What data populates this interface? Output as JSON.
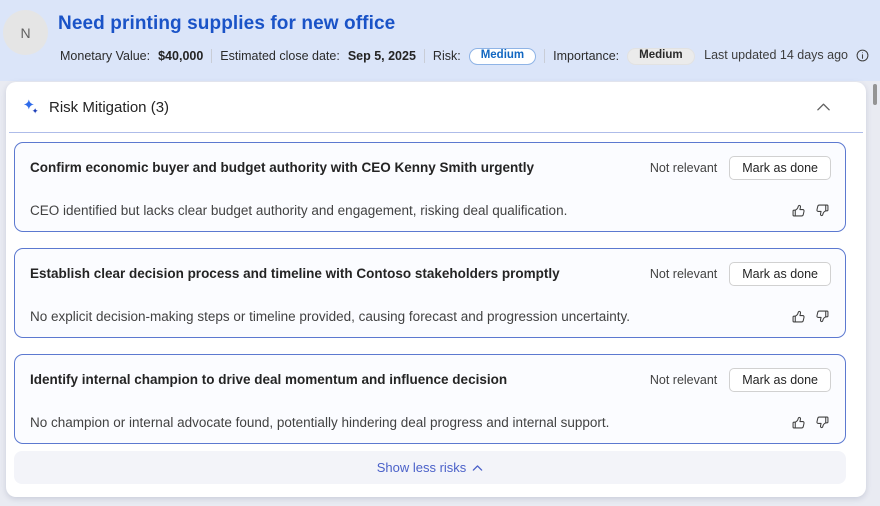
{
  "header": {
    "avatar_initial": "N",
    "title": "Need printing supplies for new office",
    "fields": [
      {
        "label": "Monetary Value:",
        "value": "$40,000"
      },
      {
        "label": "Estimated close date:",
        "value": "Sep 5, 2025"
      }
    ],
    "risk": {
      "label": "Risk:",
      "value": "Medium"
    },
    "importance": {
      "label": "Importance:",
      "value": "Medium"
    },
    "last_updated": "Last updated 14 days ago"
  },
  "section": {
    "title": "Risk Mitigation (3)"
  },
  "card_actions": {
    "not_relevant": "Not relevant",
    "mark_as_done": "Mark as done"
  },
  "risks": [
    {
      "title": "Confirm economic buyer and budget authority with CEO Kenny Smith urgently",
      "description": "CEO identified but lacks clear budget authority and engagement, risking deal qualification."
    },
    {
      "title": "Establish clear decision process and timeline with Contoso stakeholders promptly",
      "description": "No explicit decision-making steps or timeline provided, causing forecast and progression uncertainty."
    },
    {
      "title": "Identify internal champion to drive deal momentum and influence decision",
      "description": "No champion or internal advocate found, potentially hindering deal progress and internal support."
    }
  ],
  "footer": {
    "show_less_label": "Show less risks"
  },
  "icons": {
    "sparkle": "sparkle-icon",
    "info": "info-icon",
    "chevron_up": "chevron-up-icon",
    "thumb_up": "thumb-up-icon",
    "thumb_down": "thumb-down-icon"
  },
  "colors": {
    "header_bg": "#dbe5f9",
    "title_blue": "#1a53c7",
    "card_border": "#5c79d0",
    "risk_pill_text": "#1267c1",
    "link_blue": "#4b61c9",
    "section_divider": "#aebce9"
  }
}
